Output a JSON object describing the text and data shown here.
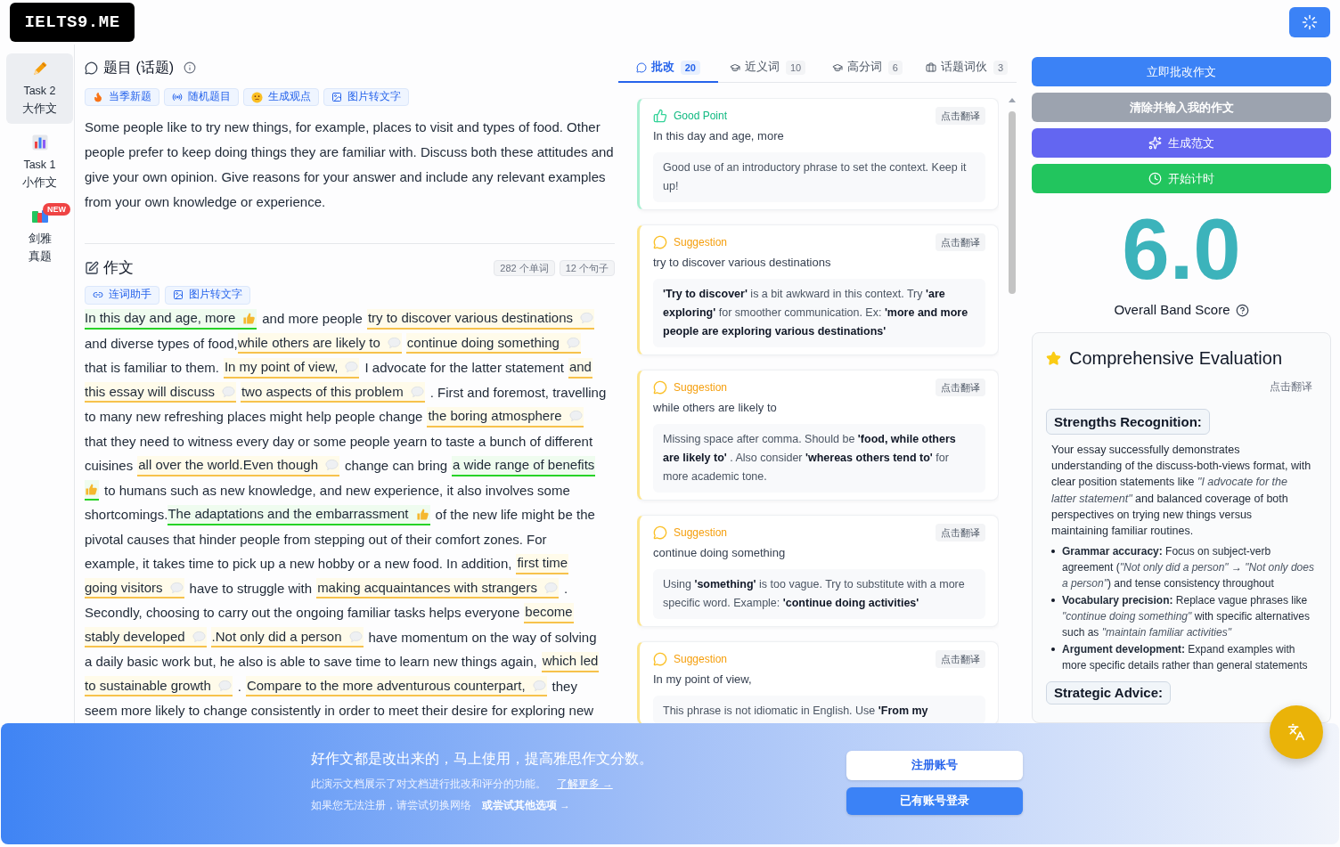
{
  "header": {
    "logo": "IELTS9.ME"
  },
  "sidebar": {
    "items": [
      {
        "lines": [
          "Task 2",
          "大作文"
        ],
        "selected": true
      },
      {
        "lines": [
          "Task 1",
          "小作文"
        ],
        "selected": false
      },
      {
        "lines": [
          "剑雅",
          "真题"
        ],
        "selected": false,
        "badge": "NEW"
      }
    ]
  },
  "topic": {
    "title": "题目 (话题)",
    "tools": [
      "当季新题",
      "随机题目",
      "生成观点",
      "图片转文字"
    ],
    "prompt": "Some people like to try new things, for example, places to visit and types of food. Other people prefer to keep doing things they are familiar with. Discuss both these attitudes and give your own opinion. Give reasons for your answer and include any relevant examples from your own knowledge or experience."
  },
  "essay": {
    "title": "作文",
    "stats": [
      "282 个单词",
      "12 个句子"
    ],
    "tools": [
      "连词助手",
      "图片转文字"
    ],
    "lines": [
      [
        {
          "kind": "good",
          "text": "In this day and age, more",
          "marker": true
        },
        {
          "kind": "plain",
          "text": "and more people"
        },
        {
          "kind": "suggestion",
          "text": "try to discover various destinations",
          "marker": true
        }
      ],
      [
        {
          "kind": "plain",
          "text": "and diverse types of food,"
        },
        {
          "kind": "suggestion",
          "text": "while others are likely to",
          "marker": true,
          "attached": true
        },
        {
          "kind": "suggestion",
          "text": "continue doing something",
          "marker": true
        }
      ],
      [
        {
          "kind": "plain",
          "text": "that is familiar to them."
        },
        {
          "kind": "suggestion",
          "text": "In my point of view,",
          "marker": true
        },
        {
          "kind": "plain",
          "text": "I advocate for the latter statement"
        },
        {
          "kind": "suggestion",
          "text": "and",
          "marker": false
        }
      ],
      [
        {
          "kind": "suggestion",
          "text": "this essay will discuss",
          "marker": true
        },
        {
          "kind": "suggestion",
          "text": "two aspects of this problem",
          "marker": true
        },
        {
          "kind": "plain",
          "text": ". First and foremost, travelling"
        }
      ],
      [
        {
          "kind": "plain",
          "text": "to many new refreshing places might help people change"
        },
        {
          "kind": "suggestion",
          "text": "the boring atmosphere",
          "marker": true
        }
      ],
      [
        {
          "kind": "plain",
          "text": "that they need to witness every day or some people yearn to taste a bunch of different"
        }
      ],
      [
        {
          "kind": "plain",
          "text": "cuisines"
        },
        {
          "kind": "suggestion",
          "text": "all over the world.Even though",
          "marker": true
        },
        {
          "kind": "plain",
          "text": "change can bring"
        },
        {
          "kind": "good",
          "text": "a wide range of benefits",
          "marker": false
        }
      ],
      [
        {
          "kind": "good",
          "marker": true
        },
        {
          "kind": "plain",
          "text": "to humans such as new knowledge, and new experience, it also involves some"
        }
      ],
      [
        {
          "kind": "plain",
          "text": "shortcomings."
        },
        {
          "kind": "good",
          "text": "The adaptations and the embarrassment",
          "marker": true,
          "attached": true
        },
        {
          "kind": "plain",
          "text": "of the new life might be the"
        }
      ],
      [
        {
          "kind": "plain",
          "text": "pivotal causes that hinder people from stepping out of their comfort zones. For"
        }
      ],
      [
        {
          "kind": "plain",
          "text": "example, it takes time to pick up a new hobby or a new food. In addition,"
        },
        {
          "kind": "suggestion",
          "text": "first time",
          "marker": false
        }
      ],
      [
        {
          "kind": "suggestion",
          "text": "going visitors",
          "marker": true
        },
        {
          "kind": "plain",
          "text": "have to struggle with"
        },
        {
          "kind": "suggestion",
          "text": "making acquaintances with strangers",
          "marker": true
        },
        {
          "kind": "plain",
          "text": "."
        }
      ],
      [
        {
          "kind": "plain",
          "text": "Secondly, choosing to carry out the ongoing familiar tasks helps everyone"
        },
        {
          "kind": "suggestion",
          "text": "become",
          "marker": false
        }
      ],
      [
        {
          "kind": "suggestion",
          "text": "stably developed",
          "marker": true
        },
        {
          "kind": "suggestion",
          "text": ".Not only did a person",
          "marker": true
        },
        {
          "kind": "plain",
          "text": "have momentum on the way of solving"
        }
      ],
      [
        {
          "kind": "plain",
          "text": "a daily basic work but, he also is able to save time to learn new things again,"
        },
        {
          "kind": "suggestion",
          "text": "which led",
          "marker": false
        }
      ],
      [
        {
          "kind": "suggestion",
          "text": "to sustainable growth",
          "marker": true
        },
        {
          "kind": "plain",
          "text": "."
        },
        {
          "kind": "suggestion",
          "text": "Compare to the more adventurous counterpart,",
          "marker": true
        },
        {
          "kind": "plain",
          "text": "they"
        }
      ],
      [
        {
          "kind": "plain",
          "text": "seem more likely to change consistently in order to meet their desire for exploring new"
        }
      ]
    ]
  },
  "feedback": {
    "tabs": [
      {
        "label": "批改",
        "count": "20",
        "selected": true
      },
      {
        "label": "近义词",
        "count": "10",
        "selected": false
      },
      {
        "label": "高分词",
        "count": "6",
        "selected": false
      },
      {
        "label": "话题词伙",
        "count": "3",
        "selected": false
      }
    ],
    "comments": [
      {
        "kind": "good",
        "label": "Good Point",
        "translate": "点击翻译",
        "phrase": "In this day and age, more",
        "note": "Good use of an introductory phrase to set the context. Keep it up!"
      },
      {
        "kind": "suggestion",
        "label": "Suggestion",
        "translate": "点击翻译",
        "phrase": "try to discover various destinations",
        "note": "**'Try to discover'** is a bit awkward in this context. Try **'are exploring'** for smoother communication. Ex: **'more and more people are exploring various destinations'**"
      },
      {
        "kind": "suggestion",
        "label": "Suggestion",
        "translate": "点击翻译",
        "phrase": "while others are likely to",
        "note": "Missing space after comma. Should be **'food, while others are likely to'** . Also consider **'whereas others tend to'** for more academic tone."
      },
      {
        "kind": "suggestion",
        "label": "Suggestion",
        "translate": "点击翻译",
        "phrase": "continue doing something",
        "note": "Using **'something'** is too vague. Try to substitute with a more specific word. Example: **'continue doing activities'**"
      },
      {
        "kind": "suggestion",
        "label": "Suggestion",
        "translate": "点击翻译",
        "phrase": "In my point of view,",
        "note": "This phrase is not idiomatic in English. Use **'From my**"
      }
    ]
  },
  "actions": [
    {
      "kind": "primary",
      "label": "立即批改作文"
    },
    {
      "kind": "secondary",
      "label": "清除并输入我的作文"
    },
    {
      "kind": "generate",
      "label": "生成范文"
    },
    {
      "kind": "timer",
      "label": "开始计时"
    }
  ],
  "score": {
    "value": "6.0",
    "label": "Overall Band Score"
  },
  "evaluation": {
    "title": "Comprehensive Evaluation",
    "translate": "点击翻译",
    "sections": [
      {
        "heading": "Strengths Recognition:",
        "paragraph": "Your essay successfully demonstrates understanding of the discuss-both-views format, with clear position statements like *\"I advocate for the latter statement\"* and balanced coverage of both perspectives on trying new things versus maintaining familiar routines.",
        "bullets": [
          "**Grammar accuracy:** Focus on subject-verb agreement (*\"Not only did a person\"* → *\"Not only does a person\"*) and tense consistency throughout",
          "**Vocabulary precision:** Replace vague phrases like *\"continue doing something\"* with specific alternatives such as *\"maintain familiar activities\"*",
          "**Argument development:** Expand examples with more specific details rather than general statements"
        ]
      },
      {
        "heading": "Strategic Advice:"
      }
    ]
  },
  "banner": {
    "headline": "好作文都是改出来的，马上使用，提高雅思作文分数。",
    "lines": [
      {
        "text": "此演示文档展示了对文档进行批改和评分的功能。",
        "link": "了解更多 →",
        "underlined": true
      },
      {
        "text": "如果您无法注册，请尝试切换网络",
        "link": "或尝试其他选项 →",
        "underlined": false
      }
    ],
    "buttons": [
      {
        "label": "注册账号",
        "kind": "outline"
      },
      {
        "label": "已有账号登录",
        "kind": "primary"
      }
    ]
  }
}
